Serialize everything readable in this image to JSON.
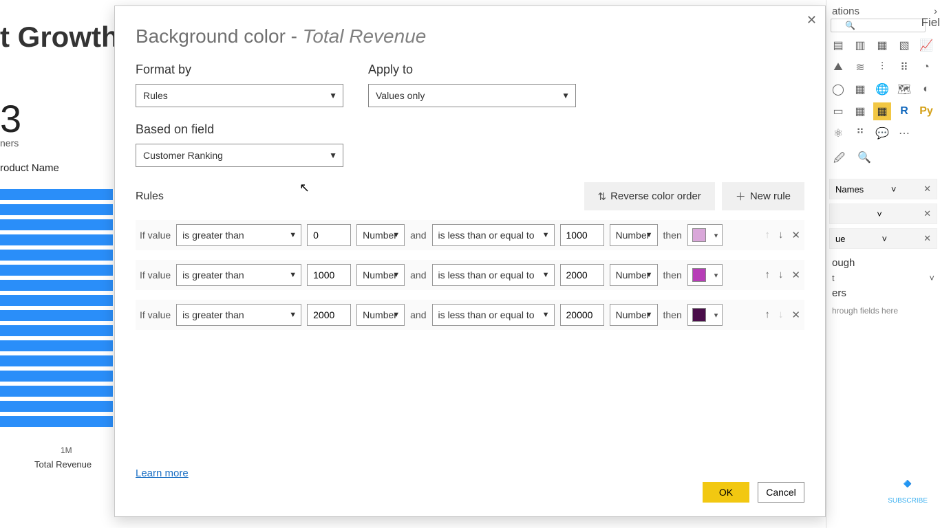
{
  "background": {
    "title_fragment": "t Growth",
    "big_number": "3",
    "subtitle_fragment": "ners",
    "product_label": "roduct Name",
    "x_tick": "1M",
    "x_axis_label": "Total Revenue"
  },
  "modal": {
    "title_prefix": "Background color - ",
    "title_measure": "Total Revenue",
    "format_by_label": "Format by",
    "format_by_value": "Rules",
    "apply_to_label": "Apply to",
    "apply_to_value": "Values only",
    "based_on_label": "Based on field",
    "based_on_value": "Customer Ranking",
    "rules_label": "Rules",
    "reverse_btn": "Reverse color order",
    "new_rule_btn": "New rule",
    "if_value": "If value",
    "and_label": "and",
    "then_label": "then",
    "number_label": "Number",
    "learn_more": "Learn more",
    "ok": "OK",
    "cancel": "Cancel",
    "rules": [
      {
        "op1": "is greater than",
        "v1": "0",
        "t1": "Number",
        "op2": "is less than or equal to",
        "v2": "1000",
        "t2": "Number",
        "color": "#D9A7D9"
      },
      {
        "op1": "is greater than",
        "v1": "1000",
        "t1": "Number",
        "op2": "is less than or equal to",
        "v2": "2000",
        "t2": "Number",
        "color": "#B73DB7"
      },
      {
        "op1": "is greater than",
        "v1": "2000",
        "t1": "Number",
        "op2": "is less than or equal to",
        "v2": "20000",
        "t2": "Number",
        "color": "#4A0E4A"
      }
    ]
  },
  "rightpane": {
    "header": "ations",
    "fields": "Fiel",
    "field1": "Names",
    "field2": "",
    "field3": "ue",
    "drill_label": "ough",
    "drill_field": "t",
    "hint": "hrough fields here",
    "subscribe": "SUBSCRIBE",
    "filters_fragment": "ers"
  }
}
